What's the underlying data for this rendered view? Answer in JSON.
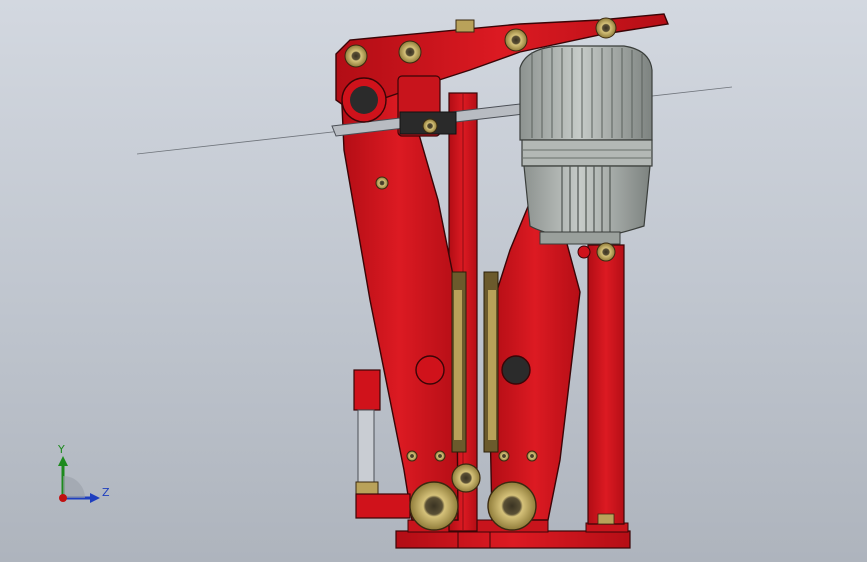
{
  "viewport": {
    "background_top": "#d3d8e0",
    "background_bottom": "#aeb4bd"
  },
  "model": {
    "primary_color": "#d0121b",
    "outline_color": "#3a0507",
    "motor_color": "#a7ada8",
    "bushing_color": "#b9a25a",
    "shaft_color": "#b8bcc2"
  },
  "triad": {
    "y_label": "Y",
    "z_label": "Z",
    "y_color": "#1d8a1d",
    "z_color": "#1f3fbf",
    "origin_color": "#c01010"
  }
}
